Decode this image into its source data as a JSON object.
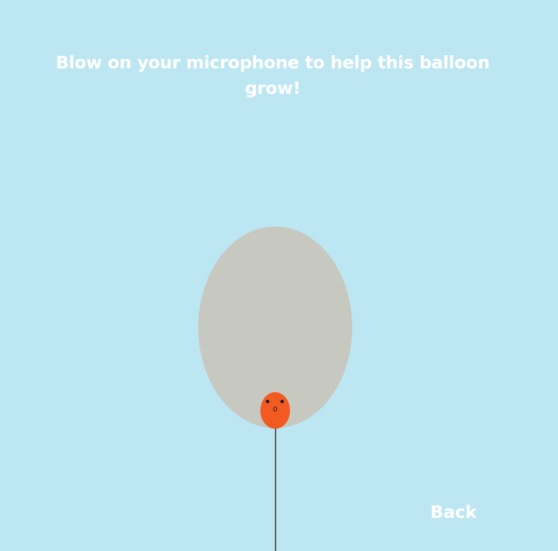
{
  "game": {
    "instruction": "Blow on your microphone to help this balloon grow!",
    "balloon_mouth": "0",
    "back_label": "Back"
  },
  "colors": {
    "background": "#bde6f3",
    "target_balloon": "#c7c9c1",
    "balloon": "#f15b22",
    "string": "#555a5c",
    "text": "#ffffff"
  }
}
